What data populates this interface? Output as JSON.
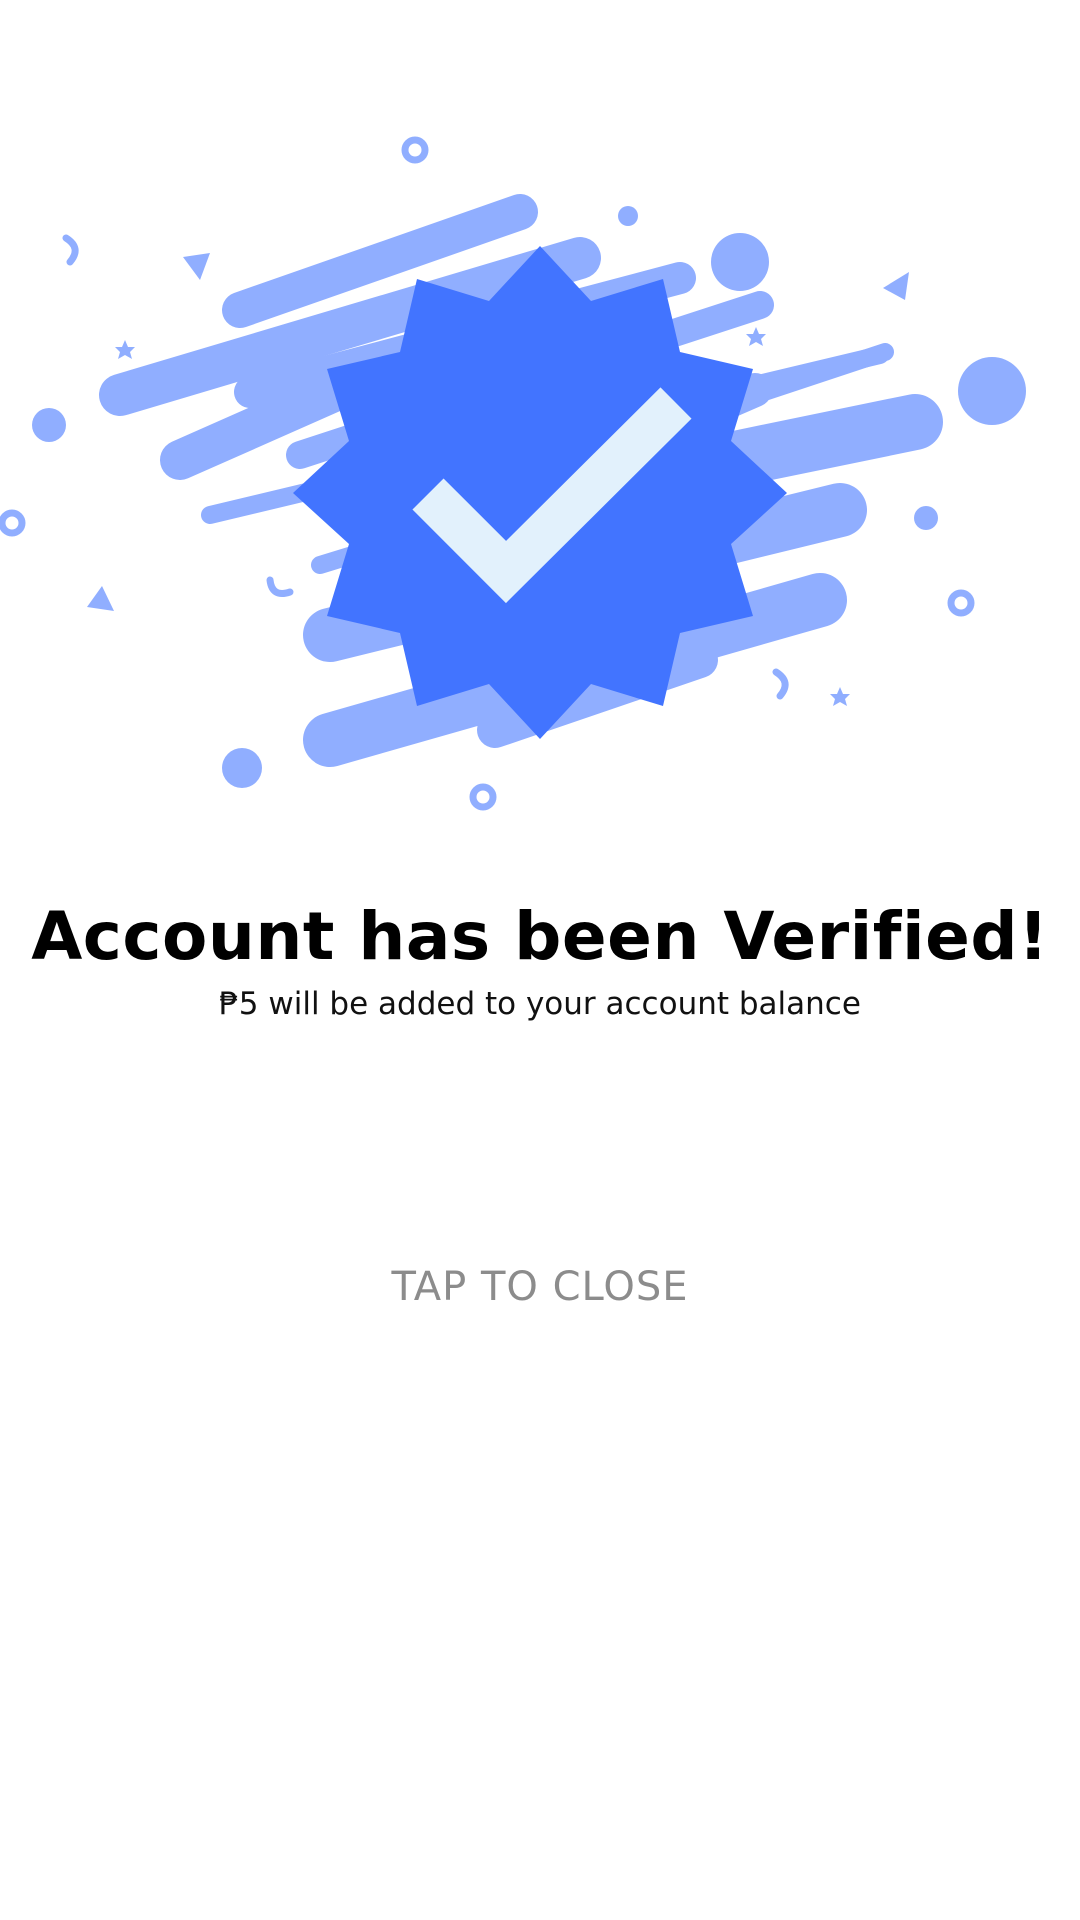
{
  "title": "Account has been Verified!",
  "subtitle": "₱5 will be added to your account balance",
  "close_label": "TAP TO CLOSE",
  "colors": {
    "badge": "#4274FF",
    "streak": "#90AEFF",
    "checkmark": "#E2F1FC",
    "title": "#000000",
    "close": "#8C8C8C"
  },
  "icons": {
    "badge": "verified-badge-icon",
    "check": "checkmark-icon"
  }
}
